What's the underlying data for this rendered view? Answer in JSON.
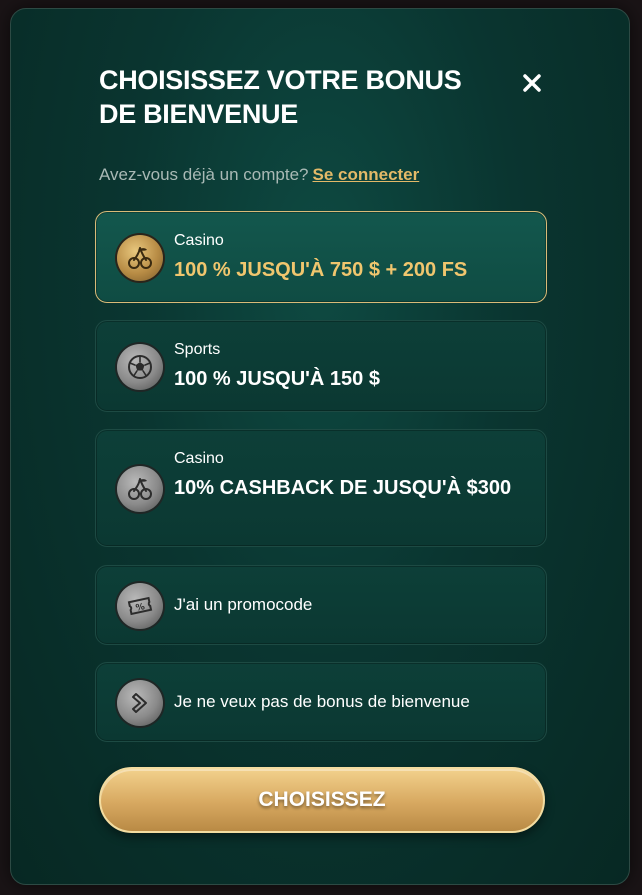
{
  "modal": {
    "title": "CHOISISSEZ VOTRE BONUS DE BIENVENUE",
    "login_prompt": "Avez-vous déjà un compte?",
    "login_link": "Se connecter"
  },
  "options": [
    {
      "category": "Casino",
      "offer": "100 % JUSQU'À 750 $ + 200 FS",
      "icon": "cherries-icon",
      "selected": true
    },
    {
      "category": "Sports",
      "offer": "100 % JUSQU'À 150 $",
      "icon": "soccer-ball-icon",
      "selected": false
    },
    {
      "category": "Casino",
      "offer": "10% CASHBACK DE JUSQU'À $300",
      "icon": "cherries-icon",
      "selected": false
    },
    {
      "label": "J'ai un promocode",
      "icon": "coupon-icon",
      "selected": false
    },
    {
      "label": "Je ne veux pas de bonus de bienvenue",
      "icon": "arrow-right-icon",
      "selected": false
    }
  ],
  "cta_label": "CHOISISSEZ",
  "colors": {
    "accent_gold": "#f0c66e",
    "link_gold": "#e3b968",
    "panel_bg": "#0a3530",
    "selected_border": "#d9bb78"
  }
}
